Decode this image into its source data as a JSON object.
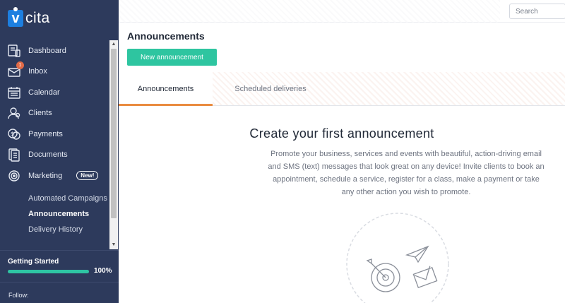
{
  "logo": {
    "text": "cita",
    "mark": "v"
  },
  "sidebar": {
    "items": [
      {
        "label": "Dashboard",
        "icon": "dashboard-icon"
      },
      {
        "label": "Inbox",
        "icon": "inbox-icon",
        "badge": "1"
      },
      {
        "label": "Calendar",
        "icon": "calendar-icon"
      },
      {
        "label": "Clients",
        "icon": "clients-icon"
      },
      {
        "label": "Payments",
        "icon": "payments-icon"
      },
      {
        "label": "Documents",
        "icon": "documents-icon"
      },
      {
        "label": "Marketing",
        "icon": "marketing-icon",
        "badge": "New!"
      }
    ],
    "subitems": [
      {
        "label": "Automated Campaigns"
      },
      {
        "label": "Announcements",
        "active": true
      },
      {
        "label": "Delivery History"
      }
    ],
    "getting_started": {
      "title": "Getting Started",
      "percent_label": "100%",
      "progress": 1.0
    },
    "follow": "Follow:"
  },
  "topbar": {
    "search_placeholder": "Search"
  },
  "main": {
    "title": "Announcements",
    "new_button": "New announcement",
    "tabs": [
      {
        "label": "Announcements",
        "active": true
      },
      {
        "label": "Scheduled deliveries",
        "active": false
      }
    ],
    "empty_state": {
      "title": "Create your first announcement",
      "description": "Promote your business, services and events with beautiful, action-driving email and SMS (text) messages that look great on any device! Invite clients to book an appointment, schedule a service, register for a class, make a payment or take any other action you wish to promote."
    }
  },
  "colors": {
    "sidebar_bg": "#2d3a5c",
    "accent_green": "#2ec5a0",
    "tab_underline": "#e98c3f",
    "badge": "#e06a47"
  }
}
